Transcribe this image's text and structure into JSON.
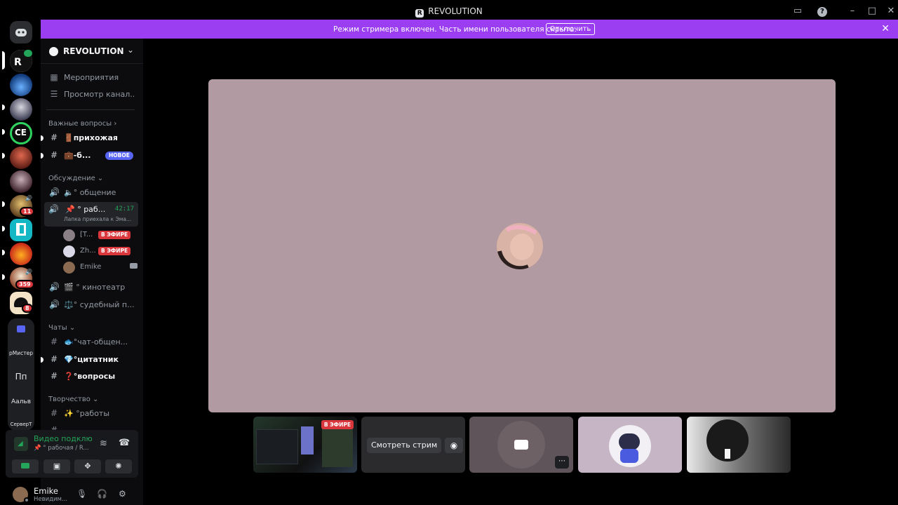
{
  "window": {
    "title": "REVOLUTION"
  },
  "banner": {
    "text": "Режим стримера включен. Часть имени пользователя скрыта.",
    "button": "Отключить"
  },
  "rail": {
    "badges": {
      "b1": "11",
      "b2": "359",
      "b3": "8"
    },
    "text_servers": [
      "рМистер",
      "Пп",
      "Аальв",
      "СерверТ"
    ]
  },
  "sidebar": {
    "server_name": "REVOLUTION",
    "events": "Мероприятия",
    "browse": "Просмотр канал...",
    "categories": {
      "important": "Важные вопросы ›",
      "discussion": "Обсуждение ⌄",
      "chats": "Чаты ⌄",
      "creative": "Творчество ⌄"
    },
    "channels": {
      "hallway": "🚪прихожая",
      "b6": "💼-б...",
      "new_tag": "НОВОЕ",
      "talk": "🔈° общение",
      "work_vc": "📌 ° раб...",
      "work_timer": "42:17",
      "work_sub": "Лапка приехала к Эма...",
      "cinema": "🎬 ° кинотеатр",
      "court": "⚖️° судебный п...",
      "chat": "🐟°чат-общен...",
      "quotes": "💎°цитатник",
      "questions": "❓°вопросы",
      "works": "✨ °работы"
    },
    "voice_users": [
      {
        "name": "[T...",
        "live": "В ЭФИРЕ"
      },
      {
        "name": "Zh...",
        "live": "В ЭФИРЕ"
      },
      {
        "name": "Emike"
      }
    ]
  },
  "voice_panel": {
    "status": "Видео подклю",
    "sub": "📌 ° рабочая / R..."
  },
  "user_panel": {
    "name": "Emike",
    "status": "Невидим..."
  },
  "tiles": {
    "live": "В ЭФИРЕ",
    "watch": "Смотреть стрим"
  },
  "colors": {
    "brand_purple": "#9b3df0",
    "stage_bg": "#b19aa1",
    "live_red": "#da373c",
    "connected_green": "#23a55a"
  }
}
